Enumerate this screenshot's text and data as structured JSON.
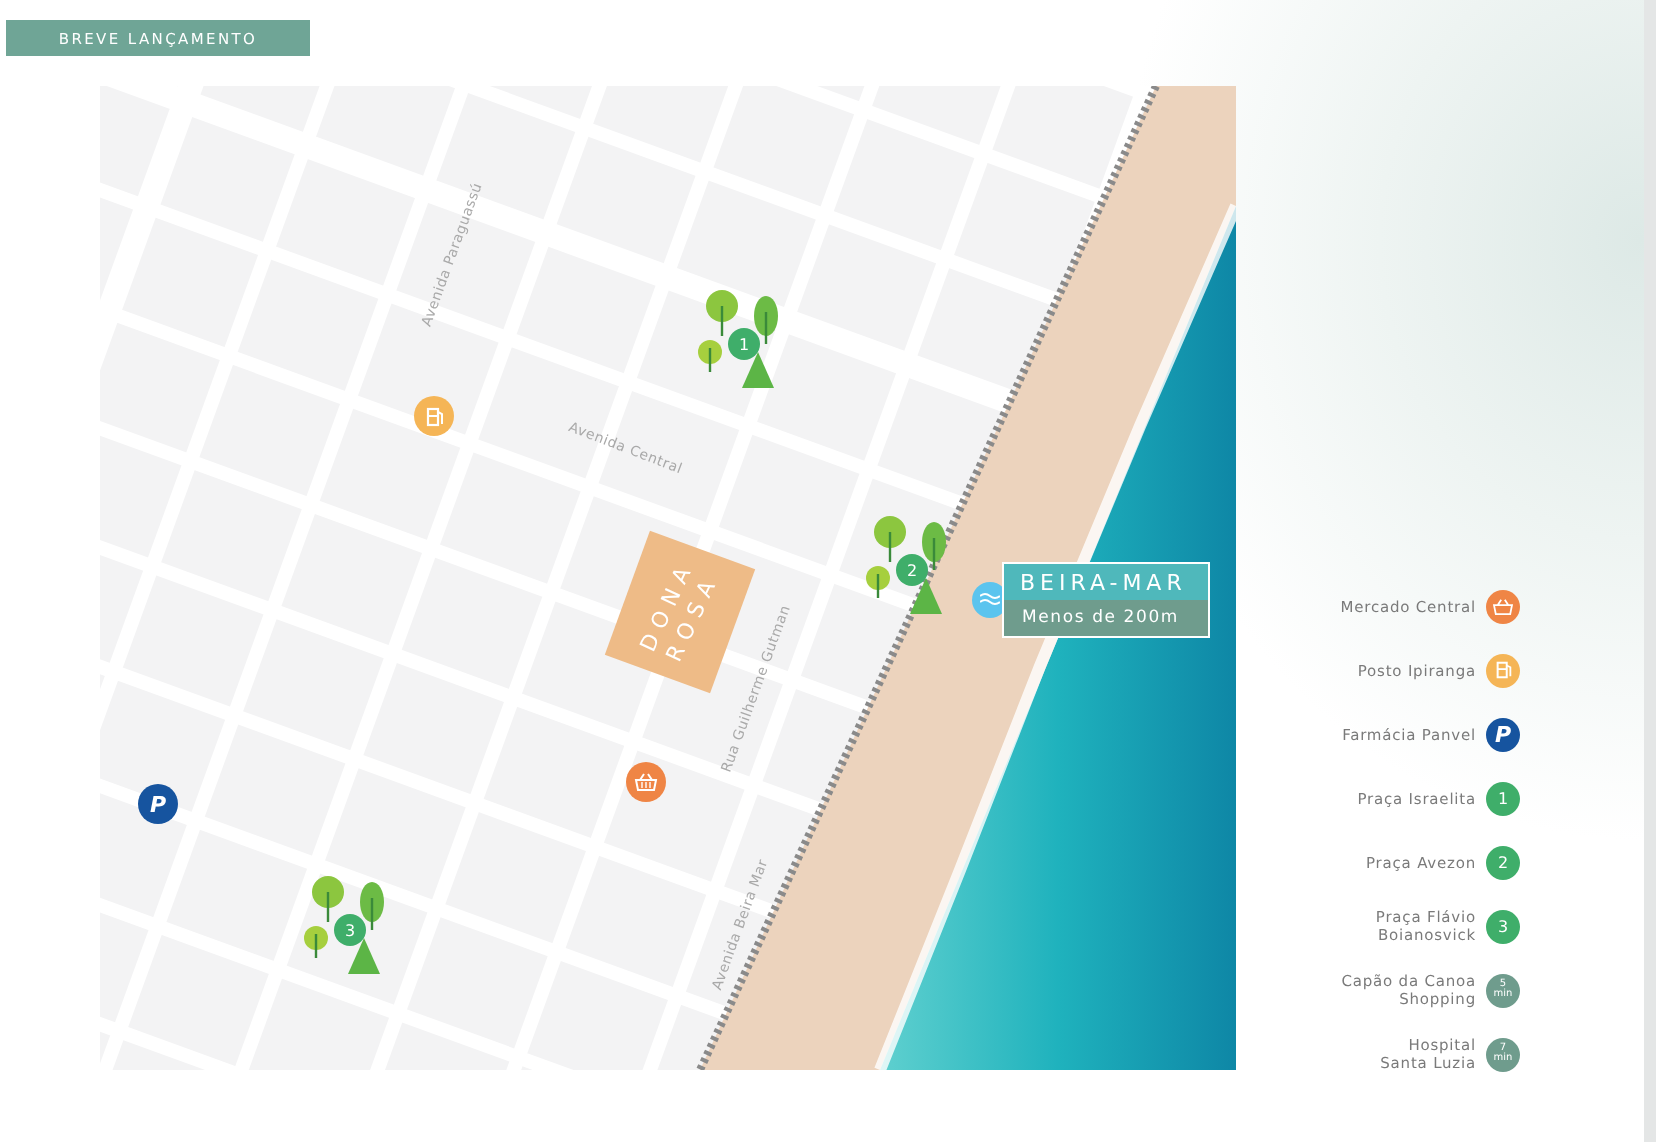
{
  "tag": "BREVE LANÇAMENTO",
  "map": {
    "streets": [
      {
        "name": "Avenida Paraguassú"
      },
      {
        "name": "Avenida Central"
      },
      {
        "name": "Rua Guilherme Gutman"
      },
      {
        "name": "Avenida Beira Mar"
      }
    ],
    "building": {
      "lines": [
        "DONA",
        "ROSA"
      ]
    },
    "callout": {
      "title": "BEIRA-MAR",
      "subtitle": "Menos de 200m"
    },
    "pins": [
      {
        "kind": "park",
        "mark": "1",
        "color": "#3fae6a"
      },
      {
        "kind": "fuel",
        "color": "#f5b556"
      },
      {
        "kind": "park",
        "mark": "2",
        "color": "#3fae6a"
      },
      {
        "kind": "basket",
        "color": "#ef8545"
      },
      {
        "kind": "letter",
        "mark": "P",
        "color": "#16549f"
      },
      {
        "kind": "park",
        "mark": "3",
        "color": "#3fae6a"
      }
    ]
  },
  "legend": [
    {
      "lines": [
        "Mercado Central"
      ],
      "kind": "basket",
      "color": "#ef8545"
    },
    {
      "lines": [
        "Posto Ipiranga"
      ],
      "kind": "fuel",
      "color": "#f5b556"
    },
    {
      "lines": [
        "Farmácia Panvel"
      ],
      "kind": "letter",
      "mark": "P",
      "color": "#16549f"
    },
    {
      "lines": [
        "Praça Israelita"
      ],
      "kind": "number",
      "mark": "1",
      "color": "#3fae6a"
    },
    {
      "lines": [
        "Praça Avezon"
      ],
      "kind": "number",
      "mark": "2",
      "color": "#3fae6a"
    },
    {
      "lines": [
        "Praça Flávio",
        "Boianosvick"
      ],
      "kind": "number",
      "mark": "3",
      "color": "#3fae6a"
    },
    {
      "lines": [
        "Capão da Canoa",
        "Shopping"
      ],
      "kind": "time",
      "mark": "5",
      "unit": "min",
      "color": "#6f9c8d"
    },
    {
      "lines": [
        "Hospital",
        "Santa Luzia"
      ],
      "kind": "time",
      "mark": "7",
      "unit": "min",
      "color": "#6f9c8d"
    }
  ]
}
